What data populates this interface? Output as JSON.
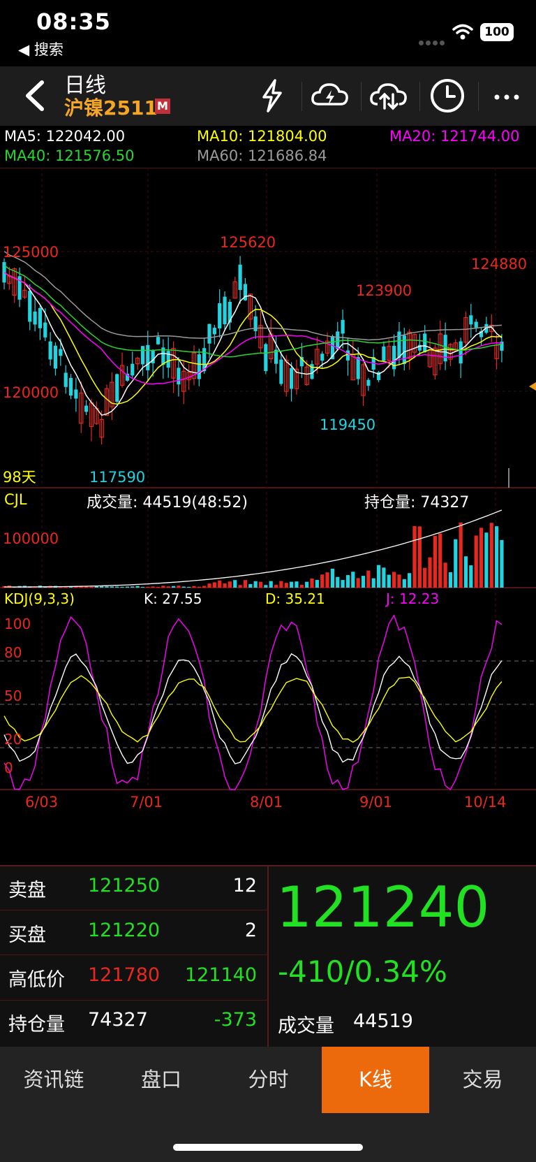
{
  "status": {
    "time": "08:35",
    "back_label": "◀ 搜索",
    "battery": "100"
  },
  "header": {
    "title": "日线",
    "contract": "沪镍2511",
    "tag": "M"
  },
  "ma": {
    "ma5": "MA5: 122042.00",
    "ma10": "MA10: 121804.00",
    "ma20": "MA20: 121744.00",
    "ma40": "MA40: 121576.50",
    "ma60": "MA60: 121686.84"
  },
  "colors": {
    "up": "#e8281e",
    "down": "#22d3e0",
    "ma5": "#ffffff",
    "ma10": "#ffff00",
    "ma20": "#ff00ff",
    "ma40": "#29d631",
    "ma60": "#9a9a9a",
    "price_green": "#22e022",
    "accent": "#ec6a0b"
  },
  "kline": {
    "price_labels": {
      "high": "125620",
      "right_high": "124880",
      "mid_high": "123900",
      "level_125": "125000",
      "level_120": "120000",
      "low_mid": "119450",
      "low": "117590"
    },
    "days": "98天"
  },
  "volume": {
    "indicator": "CJL",
    "volume_text": "成交量: 44519(48:52)",
    "oi_text": "持仓量: 74327",
    "level": "100000"
  },
  "kdj": {
    "name": "KDJ(9,3,3)",
    "k": "K: 27.55",
    "d": "D: 35.21",
    "j": "J: 12.23",
    "levels": [
      "100",
      "80",
      "50",
      "20",
      "0"
    ]
  },
  "dates": [
    "6/03",
    "7/01",
    "8/01",
    "9/01",
    "10/14"
  ],
  "quote": {
    "sell_label": "卖盘",
    "sell_price": "121250",
    "sell_qty": "12",
    "buy_label": "买盘",
    "buy_price": "121220",
    "buy_qty": "2",
    "hl_label": "高低价",
    "high": "121780",
    "low": "121140",
    "oi_label": "持仓量",
    "oi": "74327",
    "oi_change": "-373",
    "last_price": "121240",
    "change": "-410/0.34%",
    "vol_label": "成交量",
    "vol": "44519"
  },
  "tabs": [
    "资讯链",
    "盘口",
    "分时",
    "K线",
    "交易"
  ]
}
